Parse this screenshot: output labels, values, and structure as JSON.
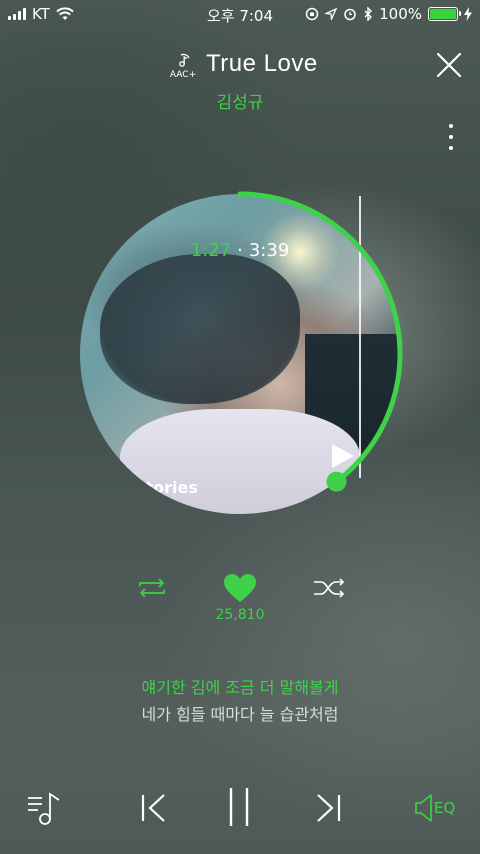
{
  "status_bar": {
    "carrier": "KT",
    "time": "오후 7:04",
    "battery": "100%"
  },
  "header": {
    "quality_label": "AAC+",
    "title": "True Love",
    "artist": "김성규"
  },
  "player": {
    "elapsed": "1:27",
    "separator": "·",
    "duration": "3:39",
    "progress_fraction": 0.397,
    "album_text": "Stories"
  },
  "actions": {
    "like_count": "25,810"
  },
  "lyrics": {
    "current": "얘기한 김에 조금 더 말해볼게",
    "next": "네가 힘들 때마다 늘 습관처럼"
  },
  "controls": {
    "eq_label": "EQ"
  },
  "colors": {
    "accent": "#3fd14a",
    "text": "#ffffff"
  }
}
